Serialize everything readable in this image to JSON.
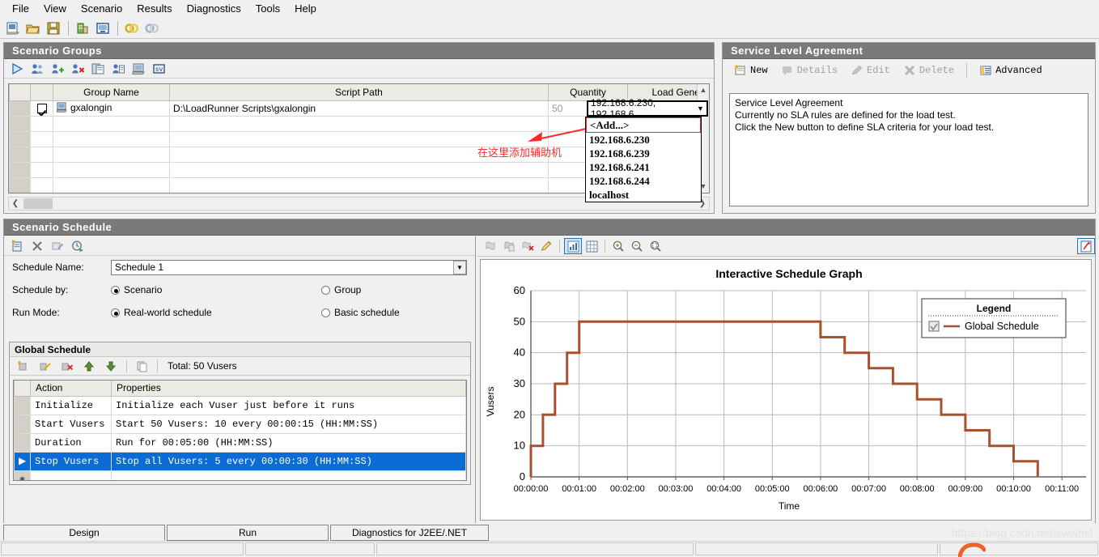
{
  "menu": {
    "items": [
      "File",
      "View",
      "Scenario",
      "Results",
      "Diagnostics",
      "Tools",
      "Help"
    ]
  },
  "main_toolbar": {
    "buttons": [
      {
        "name": "new-scenario-icon",
        "label": "New Scenario"
      },
      {
        "name": "open-scenario-icon",
        "label": "Open Scenario"
      },
      {
        "name": "save-scenario-icon",
        "label": "Save Scenario"
      },
      {
        "name": "load-generators-icon",
        "label": "Load Generators"
      },
      {
        "name": "scenario-groups-icon",
        "label": "Scenario Groups"
      },
      {
        "name": "start-scenario-icon",
        "label": "Start Scenario"
      },
      {
        "name": "stop-scenario-icon",
        "label": "Stop Scenario"
      }
    ]
  },
  "scenario_groups": {
    "title": "Scenario Groups",
    "toolbar": [
      {
        "name": "run-icon",
        "label": "Run"
      },
      {
        "name": "vusers-icon",
        "label": "Vusers"
      },
      {
        "name": "add-group-icon",
        "label": "Add Group"
      },
      {
        "name": "remove-group-icon",
        "label": "Remove Group"
      },
      {
        "name": "details-icon",
        "label": "Details"
      },
      {
        "name": "script-details-icon",
        "label": "Script Details"
      },
      {
        "name": "generators-icon",
        "label": "Load Generators"
      },
      {
        "name": "vuser-script-icon",
        "label": "View Script"
      }
    ],
    "columns": [
      "",
      "",
      "Group Name",
      "Script Path",
      "Quantity",
      "Load Generators"
    ],
    "rows": [
      {
        "checked": true,
        "group_name": "gxalongin",
        "script_path": "D:\\LoadRunner Scripts\\gxalongin",
        "quantity": "50",
        "load_generators": "192.168.6.230, 192.168.6"
      }
    ],
    "empty_row_count": 6,
    "load_generator_dropdown": {
      "open": true,
      "selected": "192.168.6.230, 192.168.6",
      "options": [
        "<Add...>",
        "192.168.6.230",
        "192.168.6.239",
        "192.168.6.241",
        "192.168.6.244",
        "localhost"
      ]
    },
    "annotation": {
      "text": "在这里添加辅助机",
      "color": "#ff2a2a"
    }
  },
  "sla": {
    "title": "Service Level Agreement",
    "buttons": [
      {
        "label": "New",
        "enabled": true,
        "icon": "new-sla-icon"
      },
      {
        "label": "Details",
        "enabled": false,
        "icon": "details-icon"
      },
      {
        "label": "Edit",
        "enabled": false,
        "icon": "pencil-icon"
      },
      {
        "label": "Delete",
        "enabled": false,
        "icon": "close-x-icon"
      },
      {
        "label": "Advanced",
        "enabled": true,
        "icon": "advanced-icon"
      }
    ],
    "body_lines": [
      "Service Level Agreement",
      "Currently no SLA rules are defined for the load test.",
      "Click the New button to define SLA criteria for your load test."
    ]
  },
  "scenario_schedule": {
    "title": "Scenario Schedule",
    "toolbar": [
      {
        "name": "new-schedule-icon",
        "label": "New Schedule"
      },
      {
        "name": "delete-schedule-icon",
        "label": "Delete Schedule"
      },
      {
        "name": "rename-schedule-icon",
        "label": "Rename Schedule"
      },
      {
        "name": "schedule-run-icon",
        "label": "Run Schedule"
      }
    ],
    "schedule_name_label": "Schedule Name:",
    "schedule_name_value": "Schedule 1",
    "schedule_by_label": "Schedule by:",
    "schedule_by_options": [
      {
        "label": "Scenario",
        "selected": true
      },
      {
        "label": "Group",
        "selected": false
      }
    ],
    "run_mode_label": "Run Mode:",
    "run_mode_options": [
      {
        "label": "Real-world schedule",
        "selected": true
      },
      {
        "label": "Basic schedule",
        "selected": false
      }
    ],
    "global_schedule": {
      "title": "Global Schedule",
      "toolbar": [
        {
          "name": "add-action-icon",
          "label": "Add Action"
        },
        {
          "name": "edit-action-icon",
          "label": "Edit Action"
        },
        {
          "name": "delete-action-icon",
          "label": "Delete Action"
        },
        {
          "name": "move-up-icon",
          "label": "Move Up"
        },
        {
          "name": "move-down-icon",
          "label": "Move Down"
        },
        {
          "name": "copy-icon",
          "label": "Copy"
        }
      ],
      "total_label": "Total: 50 Vusers",
      "columns": [
        "",
        "Action",
        "Properties"
      ],
      "rows": [
        {
          "action": "Initialize",
          "properties": "Initialize each Vuser just before it runs",
          "selected": false
        },
        {
          "action": "Start  Vusers",
          "properties": "Start 50 Vusers: 10 every 00:00:15 (HH:MM:SS)",
          "selected": false
        },
        {
          "action": "Duration",
          "properties": "Run for 00:05:00 (HH:MM:SS)",
          "selected": false
        },
        {
          "action": "Stop Vusers",
          "properties": "Stop all Vusers: 5 every 00:00:30 (HH:MM:SS)",
          "selected": true
        }
      ]
    }
  },
  "chart_panel": {
    "toolbar": [
      {
        "name": "copy-graph-icon",
        "label": "Copy",
        "pressed": false,
        "enabled": false
      },
      {
        "name": "paste-graph-icon",
        "label": "Paste",
        "pressed": false,
        "enabled": false
      },
      {
        "name": "delete-graph-icon",
        "label": "Delete",
        "pressed": false,
        "enabled": false
      },
      {
        "name": "pencil-edit-icon",
        "label": "Edit",
        "pressed": false,
        "enabled": true
      },
      {
        "name": "bar-view-icon",
        "label": "Graph View",
        "pressed": true,
        "enabled": true
      },
      {
        "name": "grid-view-icon",
        "label": "Grid View",
        "pressed": false,
        "enabled": true
      },
      {
        "name": "zoom-in-icon",
        "label": "Zoom In",
        "pressed": false,
        "enabled": true
      },
      {
        "name": "zoom-out-icon",
        "label": "Zoom Out",
        "pressed": false,
        "enabled": true
      },
      {
        "name": "zoom-reset-icon",
        "label": "Reset Zoom",
        "pressed": false,
        "enabled": true
      }
    ],
    "expand_icon": "expand-graph-icon"
  },
  "chart_data": {
    "type": "line",
    "title": "Interactive Schedule Graph",
    "xlabel": "Time",
    "ylabel": "Vusers",
    "xtick_labels": [
      "00:00:00",
      "00:01:00",
      "00:02:00",
      "00:03:00",
      "00:04:00",
      "00:05:00",
      "00:06:00",
      "00:07:00",
      "00:08:00",
      "00:09:00",
      "00:10:00",
      "00:11:00"
    ],
    "ytick_labels": [
      "0",
      "10",
      "20",
      "30",
      "40",
      "50",
      "60"
    ],
    "ylim": [
      0,
      60
    ],
    "xlim_seconds": [
      0,
      690
    ],
    "grid": true,
    "legend_position": "top-right",
    "legend_title": "Legend",
    "series": [
      {
        "name": "Global Schedule",
        "color": "#a8512c",
        "checked": true,
        "step": true,
        "points": [
          {
            "t": 0,
            "v": 0
          },
          {
            "t": 0,
            "v": 10
          },
          {
            "t": 15,
            "v": 10
          },
          {
            "t": 15,
            "v": 20
          },
          {
            "t": 30,
            "v": 20
          },
          {
            "t": 30,
            "v": 30
          },
          {
            "t": 45,
            "v": 30
          },
          {
            "t": 45,
            "v": 40
          },
          {
            "t": 60,
            "v": 40
          },
          {
            "t": 60,
            "v": 50
          },
          {
            "t": 360,
            "v": 50
          },
          {
            "t": 360,
            "v": 45
          },
          {
            "t": 390,
            "v": 45
          },
          {
            "t": 390,
            "v": 40
          },
          {
            "t": 420,
            "v": 40
          },
          {
            "t": 420,
            "v": 35
          },
          {
            "t": 450,
            "v": 35
          },
          {
            "t": 450,
            "v": 30
          },
          {
            "t": 480,
            "v": 30
          },
          {
            "t": 480,
            "v": 25
          },
          {
            "t": 510,
            "v": 25
          },
          {
            "t": 510,
            "v": 20
          },
          {
            "t": 540,
            "v": 20
          },
          {
            "t": 540,
            "v": 15
          },
          {
            "t": 570,
            "v": 15
          },
          {
            "t": 570,
            "v": 10
          },
          {
            "t": 600,
            "v": 10
          },
          {
            "t": 600,
            "v": 5
          },
          {
            "t": 630,
            "v": 5
          },
          {
            "t": 630,
            "v": 0
          }
        ]
      }
    ]
  },
  "tabs": [
    {
      "label": "Design",
      "active": true
    },
    {
      "label": "Run",
      "active": false
    },
    {
      "label": "Diagnostics for J2EE/.NET",
      "active": false
    }
  ],
  "watermark": "https://blog.csdn.net/swwhxl",
  "colors": {
    "panel_title_bg": "#7a7a7a",
    "selection": "#0a6cd4",
    "chart_line": "#a8512c",
    "link_header": "#1a52b5",
    "annotation": "#ff2a2a"
  }
}
